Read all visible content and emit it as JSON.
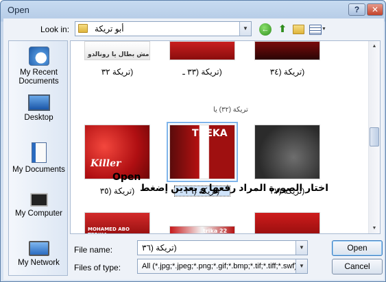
{
  "window": {
    "title": "Open",
    "help_label": "?",
    "close_label": "✕"
  },
  "toolbar": {
    "look_in_label": "Look in:",
    "look_in_value": "أبو تريكة",
    "icons": [
      "back-icon",
      "up-folder-icon",
      "new-folder-icon",
      "views-menu-icon"
    ]
  },
  "places": [
    {
      "label": "My Recent Documents",
      "icon": "recent-documents-icon"
    },
    {
      "label": "Desktop",
      "icon": "desktop-icon"
    },
    {
      "label": "My Documents",
      "icon": "my-documents-icon"
    },
    {
      "label": "My Computer",
      "icon": "my-computer-icon"
    },
    {
      "label": "My Network",
      "icon": "network-icon"
    }
  ],
  "files": {
    "row1_labels": [
      "(تريكة ٣٢",
      "(تريكة (٣٣ ـ",
      "(تريكة (٣٤"
    ],
    "row1_image_caption": "مش بطال يا رونالدو",
    "garbled_text": "تريكة (٣٢) يا",
    "row2": [
      {
        "label": "(تريكة (٣٥",
        "image_text": "Killer"
      },
      {
        "label": "(تريكة (٣٦",
        "image_text": "TREKA",
        "selected": true
      },
      {
        "label": "(تريكة (٣٧",
        "image_text": ""
      }
    ],
    "row3_image_texts": [
      "MOHAMED ABO TERIKA",
      "trika 22",
      ""
    ]
  },
  "annotation": {
    "open_word": "Open",
    "arabic_text": "اختار الصورة المراد رفعها و بعدين إضغط"
  },
  "form": {
    "file_name_label": "File name:",
    "file_name_value": "(تريكة (٣٦",
    "file_type_label": "Files of type:",
    "file_type_value": "All (*.jpg;*.jpeg;*.png;*.gif;*.bmp;*.tif;*.tiff;*.swf)",
    "open_label": "Open",
    "cancel_label": "Cancel"
  }
}
